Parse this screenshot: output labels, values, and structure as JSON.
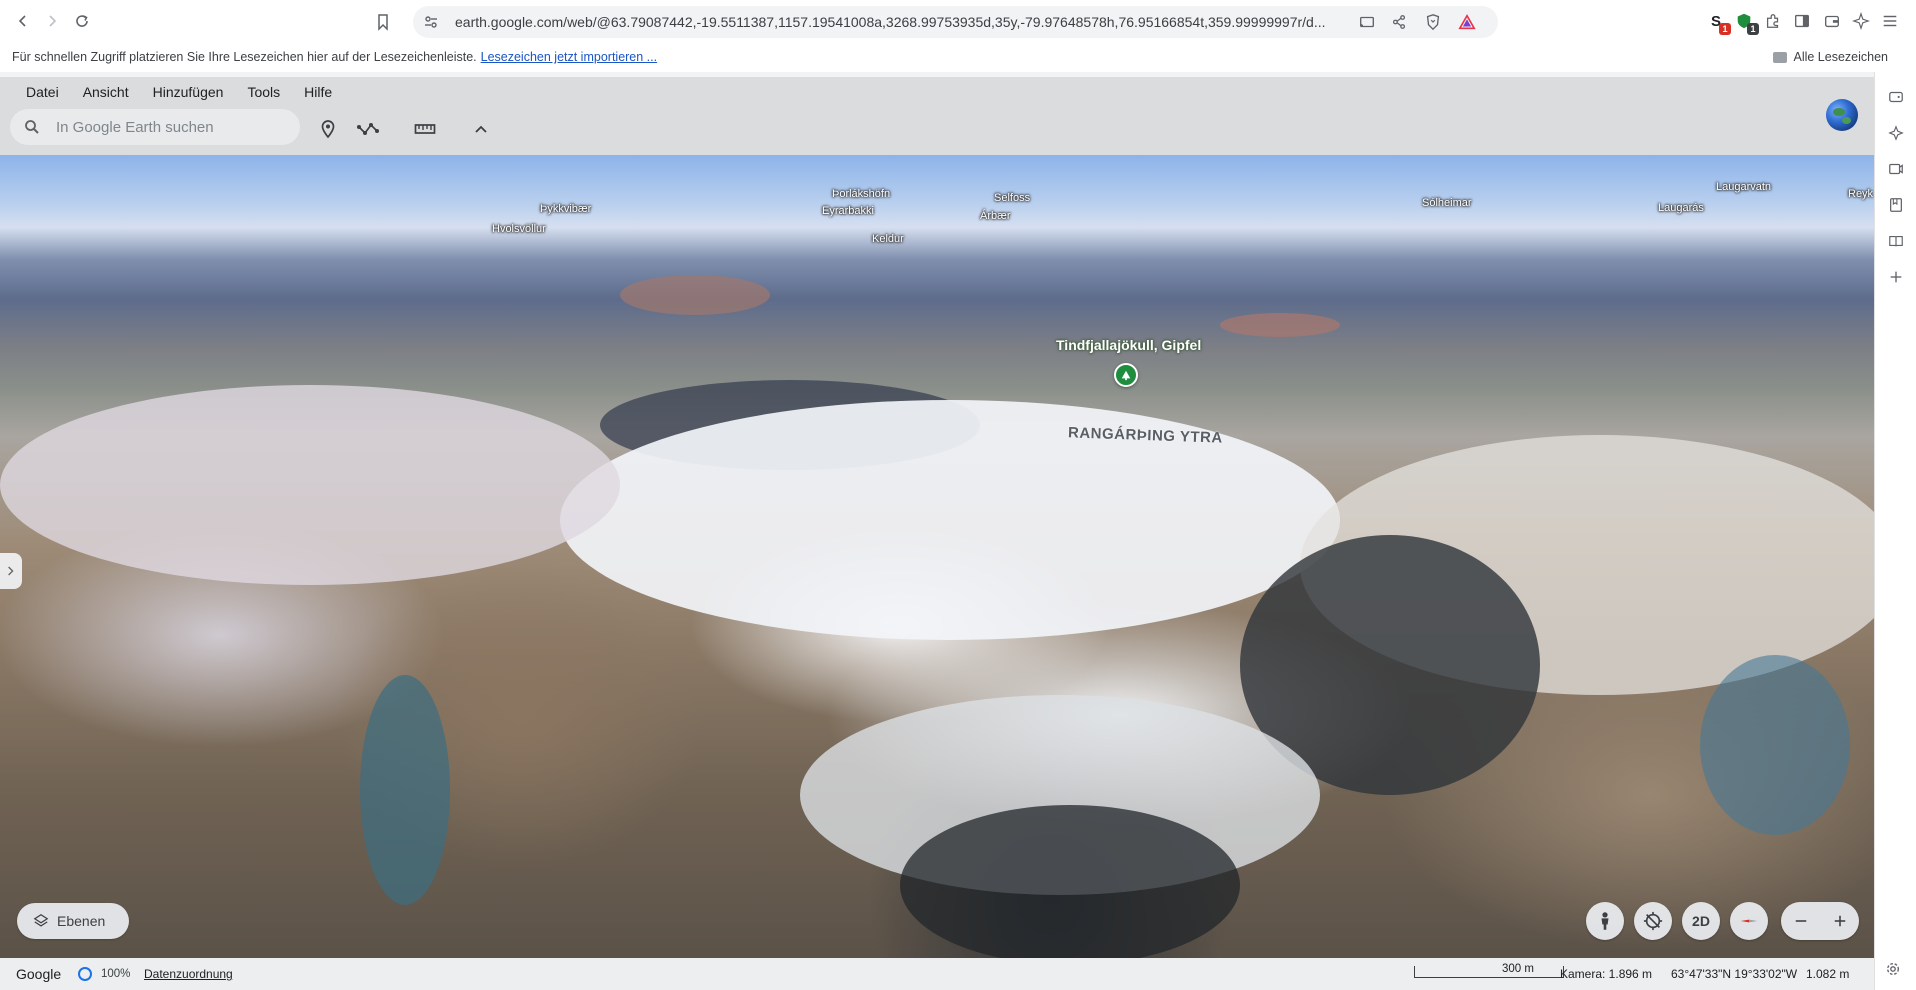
{
  "browser": {
    "url": "earth.google.com/web/@63.79087442,-19.5511387,1157.19541008a,3268.99753935d,35y,-79.97648578h,76.95166854t,359.99999997r/d...",
    "extensions": [
      {
        "name": "s-extension-icon",
        "badge": "1",
        "badge_color": "#d93025"
      },
      {
        "name": "shield-extension-icon",
        "badge": "1",
        "badge_color": "#1e8e3e"
      }
    ],
    "bookmarks_hint": "Für schnellen Zugriff platzieren Sie Ihre Lesezeichen hier auf der Lesezeichenleiste.",
    "bookmarks_import_link": "Lesezeichen jetzt importieren ...",
    "all_bookmarks": "Alle Lesezeichen"
  },
  "earth": {
    "menu": [
      "Datei",
      "Ansicht",
      "Hinzufügen",
      "Tools",
      "Hilfe"
    ],
    "search_placeholder": "In Google Earth suchen",
    "layers_label": "Ebenen",
    "view_mode": "2D",
    "map_labels": {
      "thykkvibaer": "Þykkvibær",
      "hvolsvollur": "Hvolsvöllur",
      "thorlakshofn": "Þorlákshöfn",
      "eyrarbakki": "Eyrarbakki",
      "selfoss": "Selfoss",
      "arbaer": "Árbær",
      "keldur": "Keldur",
      "solheimar": "Sólheimar",
      "laugarvatn": "Laugarvatn",
      "laugaras": "Laugarás",
      "reyk": "Reyk",
      "peak": "Tindfjallajökull, Gipfel",
      "region": "RANGÁRÞING YTRA"
    },
    "footer": {
      "brand": "Google",
      "load_percent": "100%",
      "data_attribution": "Datenzuordnung",
      "scale": "300 m",
      "camera": "Kamera: 1.896 m",
      "coordinates": "63°47'33\"N 19°33'02\"W",
      "altitude": "1.082 m"
    }
  },
  "colors": {
    "accent": "#1a73e8",
    "peak_pin": "#1e8e3e",
    "link": "#1a56c4"
  }
}
